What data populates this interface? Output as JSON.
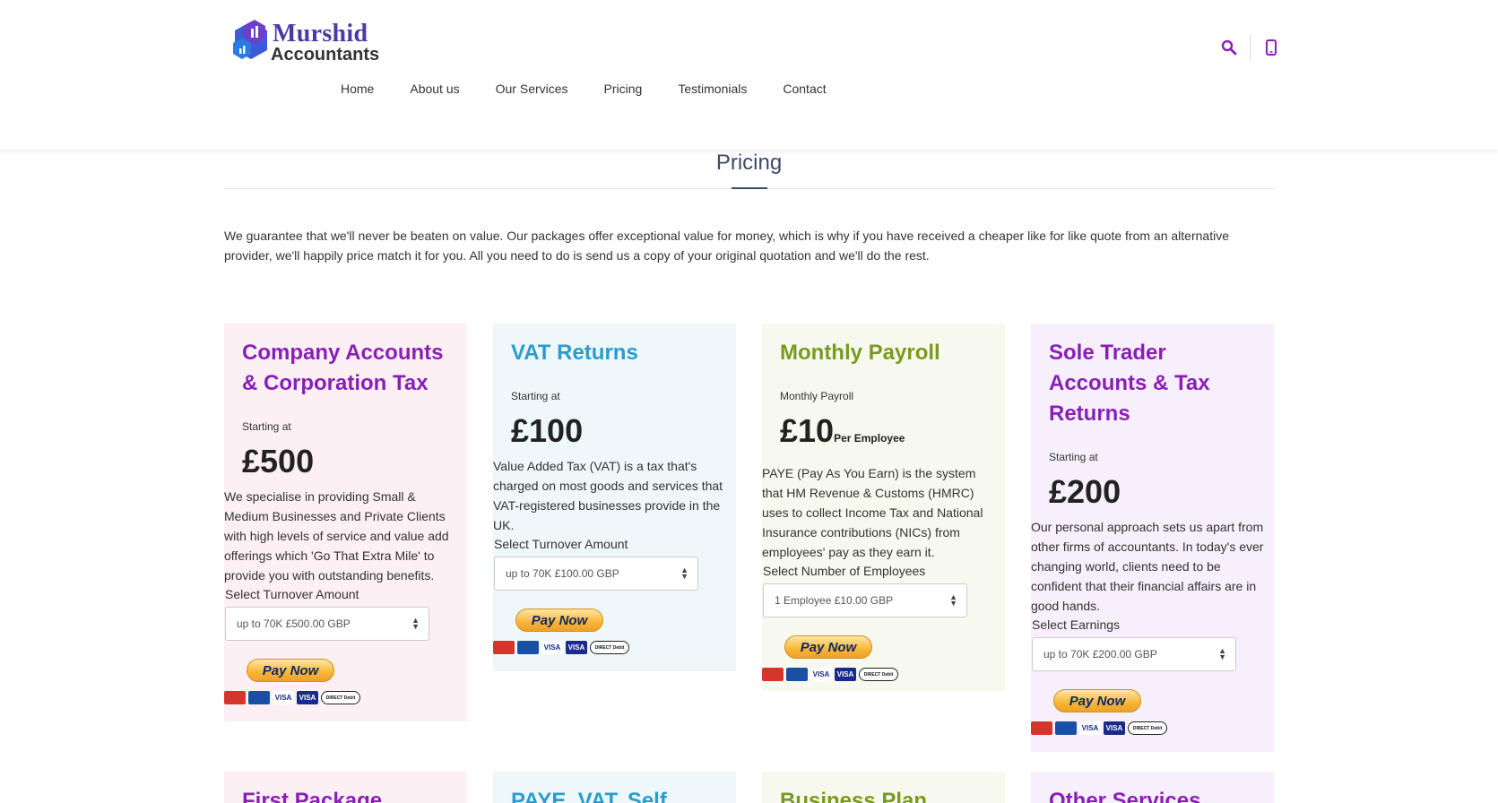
{
  "brand": {
    "name_line1": "Murshid",
    "name_line2": "Accountants"
  },
  "nav": {
    "items": [
      "Home",
      "About us",
      "Our Services",
      "Pricing",
      "Testimonials",
      "Contact"
    ]
  },
  "header_icons": [
    "search-icon",
    "mobile-phone-icon"
  ],
  "colors": {
    "accent_purple": "#8a1fb8",
    "accent_blue": "#2b9ccd",
    "accent_green": "#7a9a1d",
    "title_navy": "#3d4a6b"
  },
  "pricing": {
    "title": "Pricing",
    "intro": "We guarantee that we'll never be beaten on value. Our packages offer exceptional value for money, which is why if you have received a cheaper like for like quote from an alternative provider, we'll happily price match it for you. All you need to do is send us a copy of your original quotation and we'll do the rest."
  },
  "cards": [
    {
      "title": "Company Accounts & Corporation Tax",
      "sub": "Starting at",
      "price": "£500",
      "unit": "",
      "desc": "We specialise in providing Small & Medium Businesses and Private Clients with high levels of service and value add offerings which 'Go That Extra Mile' to provide you with outstanding benefits.",
      "select_label": "Select Turnover Amount",
      "select_value": "up to 70K £500.00 GBP",
      "pay_label": "Pay Now"
    },
    {
      "title": "VAT Returns",
      "sub": "Starting at",
      "price": "£100",
      "unit": "",
      "desc": "Value Added Tax (VAT) is a tax that's charged on most goods and services that VAT-registered businesses provide in the UK.",
      "select_label": "Select Turnover Amount",
      "select_value": "up to 70K £100.00 GBP",
      "pay_label": "Pay Now"
    },
    {
      "title": "Monthly Payroll",
      "sub": "Monthly Payroll",
      "price": "£10",
      "unit": "Per Employee",
      "desc": "PAYE (Pay As You Earn) is the system that HM Revenue & Customs (HMRC) uses to collect Income Tax and National Insurance contributions (NICs) from employees' pay as they earn it.",
      "select_label": "Select Number of Employees",
      "select_value": "1 Employee £10.00 GBP",
      "pay_label": "Pay Now"
    },
    {
      "title": "Sole Trader Accounts & Tax Returns",
      "sub": "Starting at",
      "price": "£200",
      "unit": "",
      "desc": "Our personal approach sets us apart from other firms of accountants. In today's ever changing world, clients need to be confident that their financial affairs are in good hands.",
      "select_label": "Select Earnings",
      "select_value": "up to 70K £200.00 GBP",
      "pay_label": "Pay Now"
    }
  ],
  "cards_row2": [
    {
      "title": "First Package"
    },
    {
      "title": "PAYE, VAT, Self"
    },
    {
      "title": "Business Plan"
    },
    {
      "title": "Other Services"
    }
  ],
  "payment_marks": [
    "MasterCard",
    "Maestro",
    "VISA",
    "VISA",
    "DIRECT Debit"
  ]
}
